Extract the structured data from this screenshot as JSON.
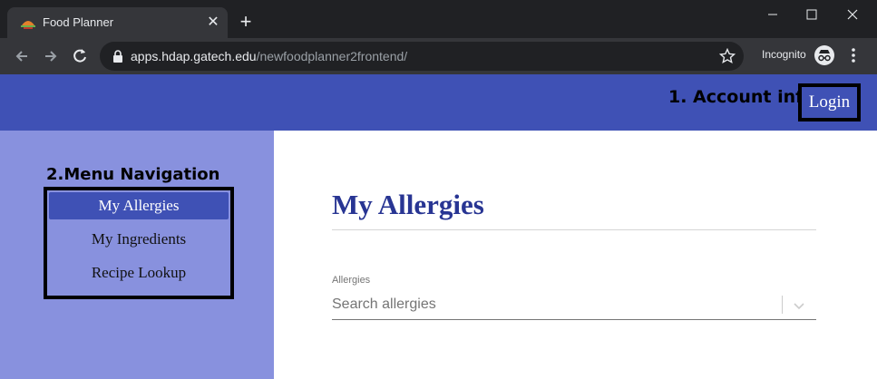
{
  "browser": {
    "tab_title": "Food Planner",
    "url_host": "apps.hdap.gatech.edu",
    "url_path": "/newfoodplanner2frontend/",
    "incognito_label": "Incognito",
    "new_tab_symbol": "+",
    "close_symbol": "✕"
  },
  "header": {
    "account_label": "1. Account info",
    "login_label": "Login"
  },
  "sidebar": {
    "heading": "2.Menu Navigation",
    "items": [
      {
        "label": "My Allergies",
        "active": true
      },
      {
        "label": "My Ingredients",
        "active": false
      },
      {
        "label": "Recipe Lookup",
        "active": false
      }
    ]
  },
  "main": {
    "title": "My Allergies",
    "field_label": "Allergies",
    "search_placeholder": "Search allergies"
  },
  "colors": {
    "header_bg": "#3f51b5",
    "sidebar_bg": "#8891de",
    "title_color": "#283593"
  },
  "icons": [
    "food-favicon-icon",
    "back-arrow-icon",
    "forward-arrow-icon",
    "reload-icon",
    "lock-icon",
    "star-icon",
    "incognito-icon",
    "more-vert-icon",
    "chevron-down-icon"
  ]
}
